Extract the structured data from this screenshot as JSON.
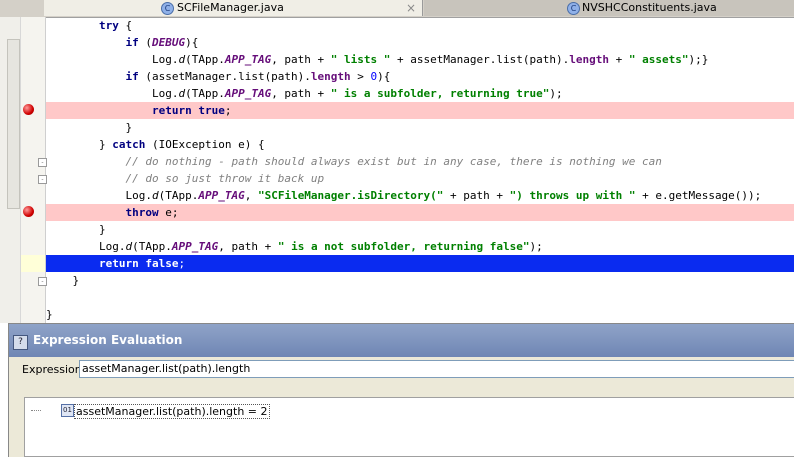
{
  "tabs": [
    {
      "label": "SCFileManager.java",
      "icon": "java-class-icon",
      "close": "×"
    },
    {
      "label": "NVSHCConstituents.java",
      "icon": "java-class-icon"
    }
  ],
  "code_lines": [
    "try {",
    "if (DEBUG){",
    "Log.d(TApp.APP_TAG, path + \" lists \" + assetManager.list(path).length + \" assets\");}",
    "if (assetManager.list(path).length > 0){",
    "Log.d(TApp.APP_TAG, path + \" is a subfolder, returning true\");",
    "return true;",
    "}",
    "} catch (IOException e) {",
    "// do nothing - path should always exist but in any case, there is nothing we can",
    "// do so just throw it back up",
    "Log.d(TApp.APP_TAG, \"SCFileManager.isDirectory(\" + path + \") throws up with \" + e.getMessage());",
    "throw e;",
    "}",
    "Log.d(TApp.APP_TAG, path + \" is a not subfolder, returning false\");",
    "return false;",
    "}",
    "",
    "}"
  ],
  "dialog": {
    "title": "Expression Evaluation",
    "title_icon": "dialog-icon",
    "expression_label": "Expression:",
    "expression_value": "assetManager.list(path).length",
    "result_text": "assetManager.list(path).length = 2",
    "result_icon": "value-icon"
  },
  "colors": {
    "breakpoint_line": "#ffc8c8",
    "execution_line": "#0a2bf0",
    "keyword": "#000080",
    "string": "#008000",
    "static_field": "#660e7a",
    "comment": "#808080",
    "dialog_title": "#7a8fbb"
  }
}
